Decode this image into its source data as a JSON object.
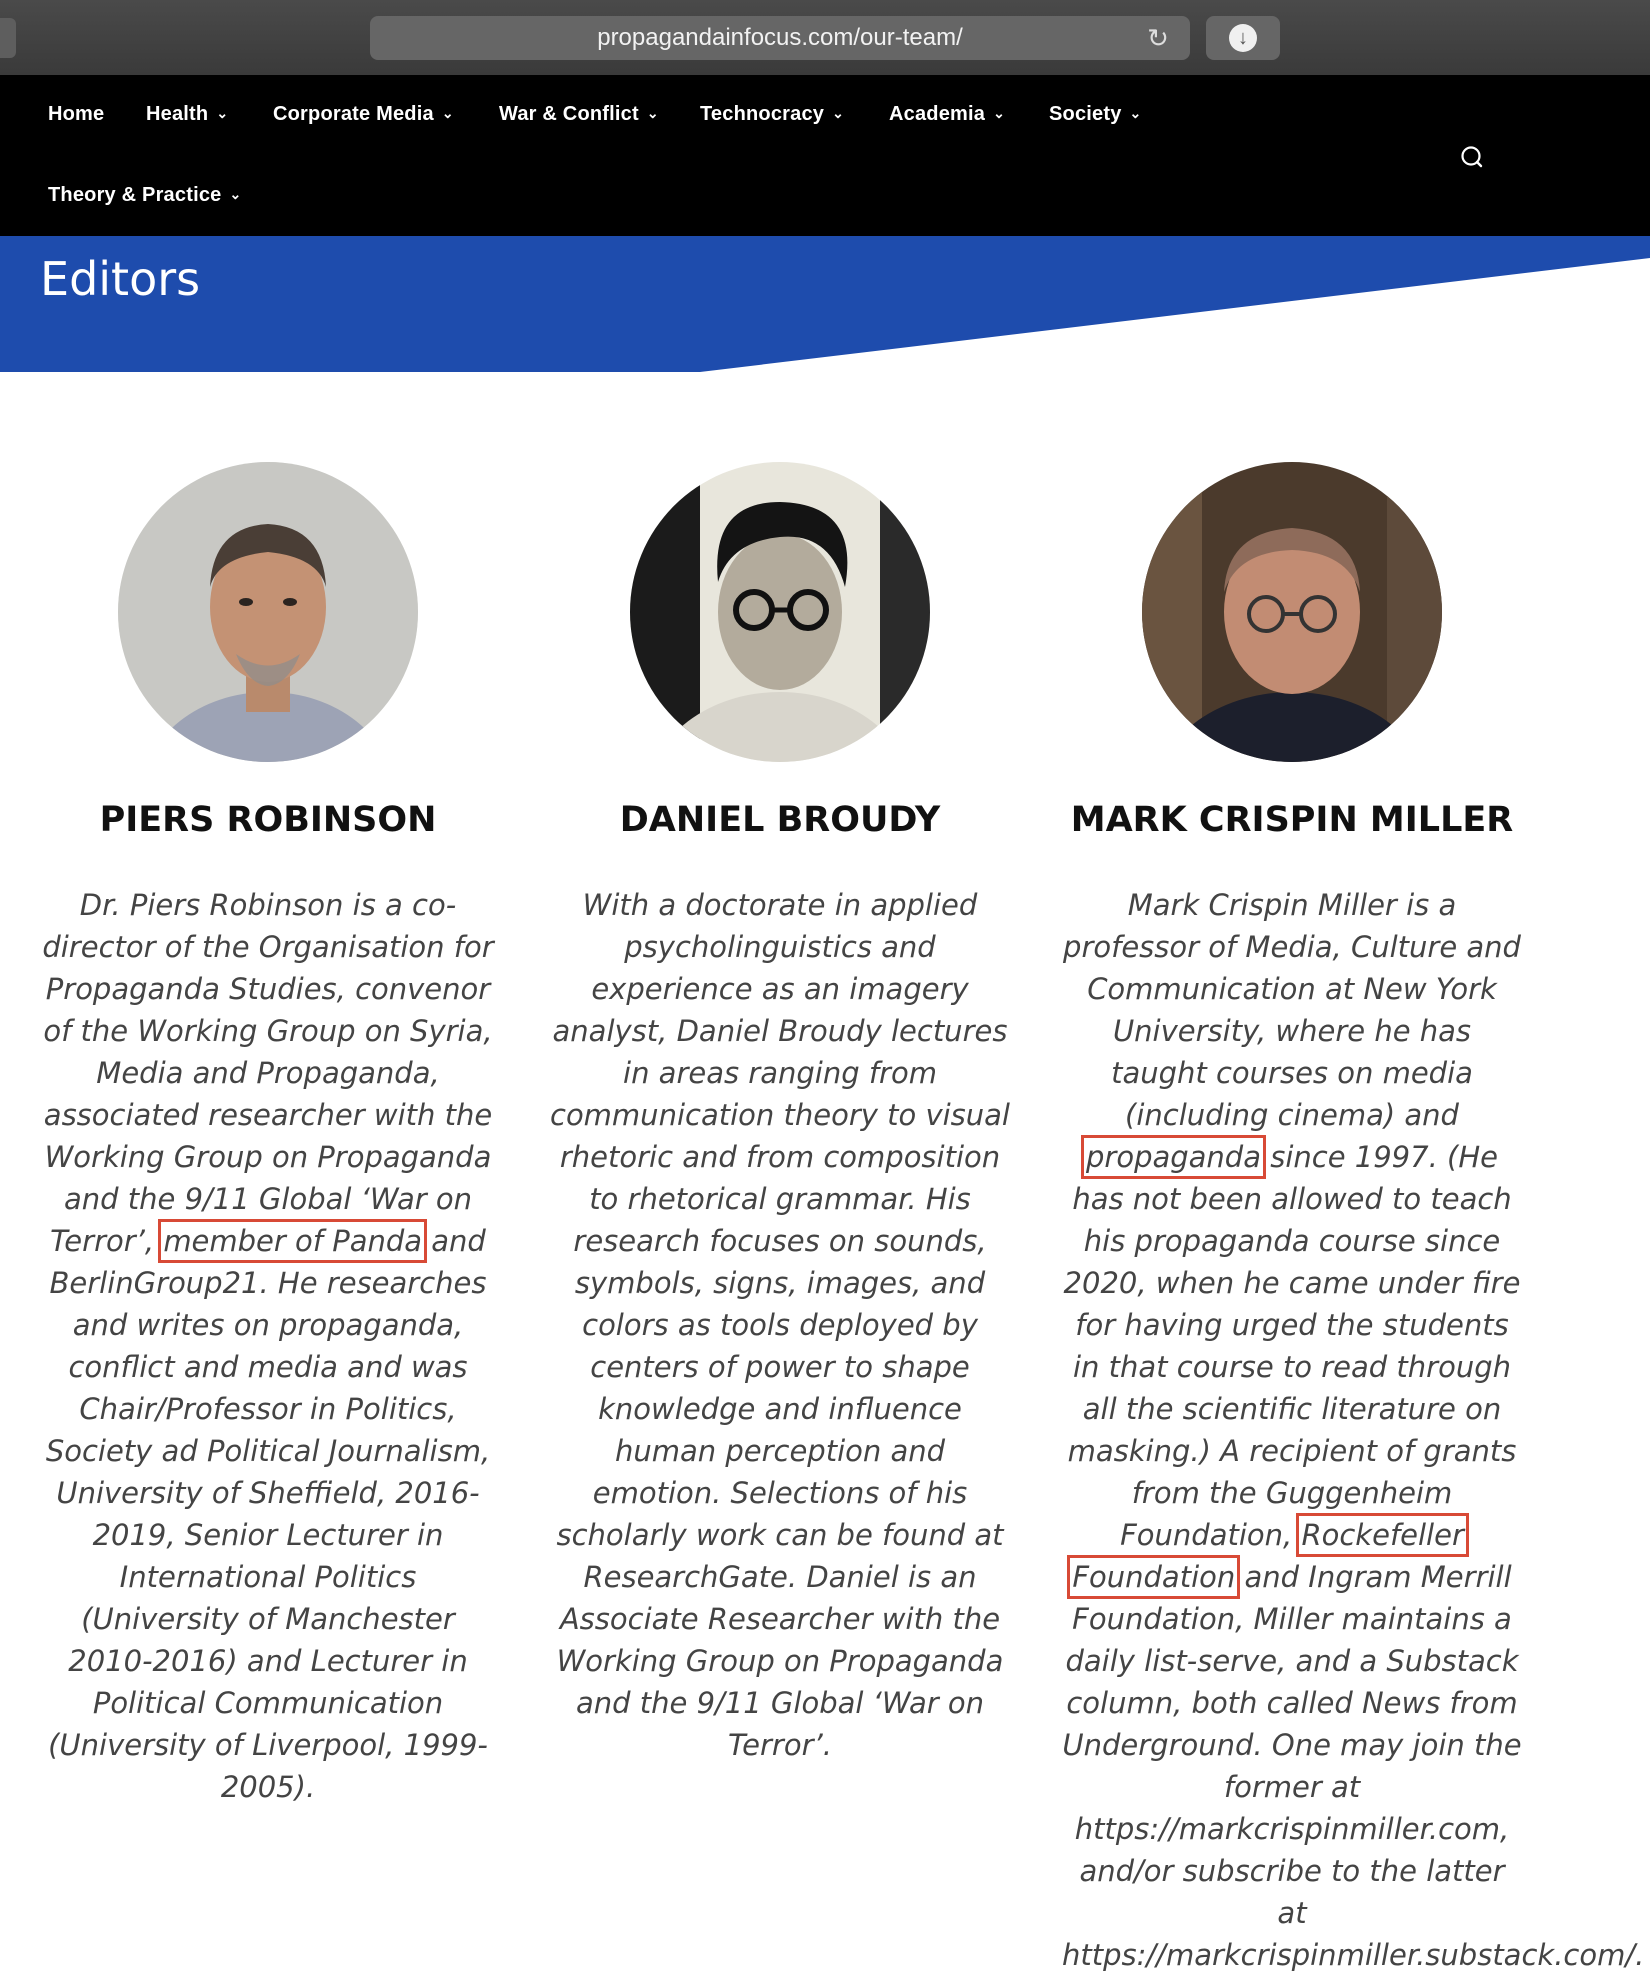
{
  "browser": {
    "url": "propagandainfocus.com/our-team/",
    "reload_icon": "reload-icon",
    "download_icon": "download-icon"
  },
  "nav": {
    "items": [
      {
        "label": "Home"
      },
      {
        "label": "Health"
      },
      {
        "label": "Corporate Media"
      },
      {
        "label": "War & Conflict"
      },
      {
        "label": "Technocracy"
      },
      {
        "label": "Academia"
      },
      {
        "label": "Society"
      },
      {
        "label": "Theory & Practice"
      }
    ],
    "search_icon": "search-icon"
  },
  "banner": {
    "title": "Editors",
    "color": "#1e4cad"
  },
  "highlight_color": "#d84a36",
  "editors": [
    {
      "name": "PIERS ROBINSON",
      "bio_before": "Dr. Piers Robinson is a co-director of the Organisation for Propaganda Studies, convenor of the Working Group on Syria, Media and Propaganda, associated researcher with the Working Group on Propaganda and the 9/11 Global ‘War on Terror’,",
      "bio_highlight": "member of Panda",
      "bio_after": "and BerlinGroup21. He researches and writes on propaganda, conflict and media and was Chair/Professor in Politics, Society ad Political Journalism, University of Sheffield, 2016-2019, Senior Lecturer in International Politics (University of Manchester 2010-2016) and Lecturer in Political Communication (University of Liverpool, 1999-2005)."
    },
    {
      "name": "DANIEL BROUDY",
      "bio": "With a doctorate in applied psycholinguistics and experience as an imagery analyst, Daniel Broudy lectures in areas ranging from communication theory to visual rhetoric and from composition to rhetorical grammar. His research focuses on sounds, symbols, signs, images, and colors as tools deployed by centers of power to shape knowledge and influence human perception and emotion. Selections of his scholarly work can be found at ResearchGate. Daniel is an Associate Researcher with the Working Group on Propaganda and the 9/11 Global ‘War on Terror’."
    },
    {
      "name": "MARK CRISPIN MILLER",
      "bio_1": "Mark Crispin Miller is a professor of Media, Culture and Communication at New York University, where he has taught courses on media (including cinema) and",
      "bio_highlight_1": "propaganda",
      "bio_2": "since 1997. (He has not been allowed to teach his propaganda course since 2020, when he came under fire for having urged the students in that course to read through all the scientific literature on masking.) A recipient of grants from the Guggenheim Foundation,",
      "bio_highlight_2": "Rockefeller Foundation",
      "bio_3": "and Ingram Merrill Foundation, Miller maintains a daily list-serve, and a Substack column, both called News from Underground. One may join the former at https://markcrispinmiller.com, and/or subscribe to the latter at https://markcrispinmiller.substack.com/."
    }
  ]
}
